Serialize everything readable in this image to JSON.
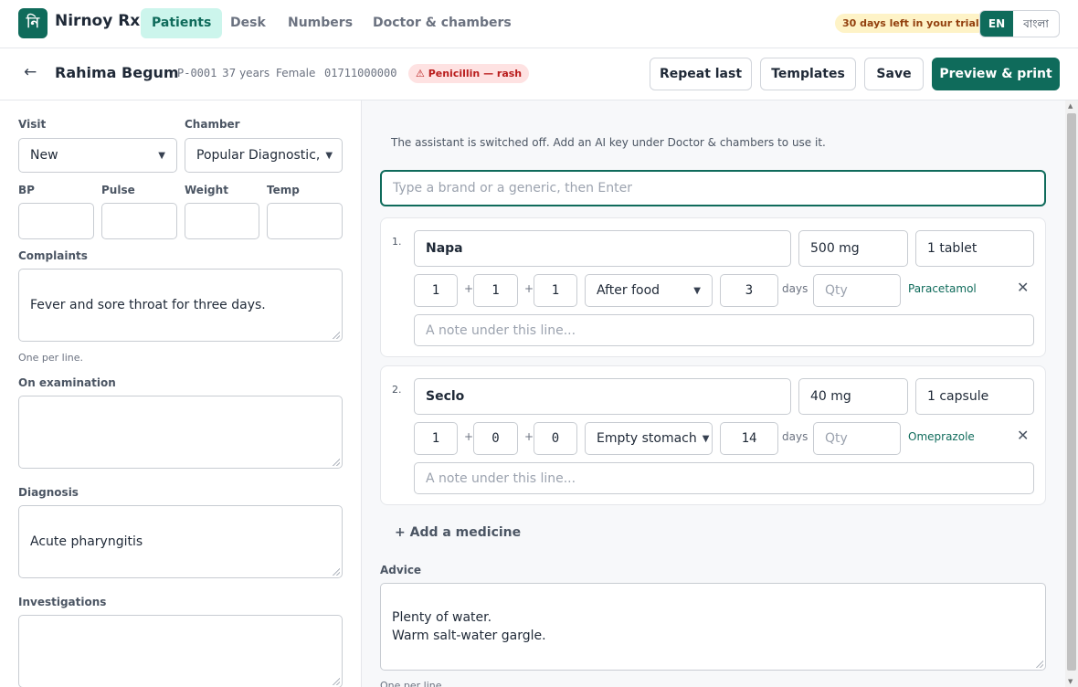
{
  "app": {
    "logo_glyph": "নি",
    "name": "Nirnoy Rx",
    "nav": [
      "Patients",
      "Desk",
      "Numbers",
      "Doctor & chambers"
    ],
    "active_nav": "Patients",
    "trial_badge": "30 days left in your trial",
    "lang_en": "EN",
    "lang_bn": "বাংলা",
    "accent_color": "#0f6b5b"
  },
  "patient": {
    "back_icon": "arrow-left-icon",
    "name": "Rahima Begum",
    "id": "P-0001",
    "age": "37 years",
    "sex": "Female",
    "phone": "01711000000",
    "allergy": "⚠ Penicillin — rash"
  },
  "actions": {
    "repeat_last": "Repeat last",
    "templates": "Templates",
    "save": "Save",
    "preview_print": "Preview & print"
  },
  "visit_form": {
    "visit_label": "Visit",
    "visit_value": "New",
    "chamber_label": "Chamber",
    "chamber_value": "Popular Diagnostic,",
    "bp_label": "BP",
    "pulse_label": "Pulse",
    "weight_label": "Weight",
    "temp_label": "Temp",
    "complaints_label": "Complaints",
    "complaints_value": "Fever and sore throat for three days.",
    "complaints_hint": "One per line.",
    "examination_label": "On examination",
    "diagnosis_label": "Diagnosis",
    "diagnosis_value": "Acute pharyngitis",
    "investigations_label": "Investigations"
  },
  "rx": {
    "assistant_notice": "The assistant is switched off. Add an AI key under Doctor & chambers to use it.",
    "search_placeholder": "Type a brand or a generic, then Enter",
    "medicines": [
      {
        "num": "1.",
        "brand": "Napa",
        "strength": "500 mg",
        "dose": "1 tablet",
        "morning": "1",
        "noon": "1",
        "night": "1",
        "timing": "After food",
        "duration": "3",
        "days_label": "days",
        "qty_placeholder": "Qty",
        "generic": "Paracetamol",
        "note_placeholder": "A note under this line..."
      },
      {
        "num": "2.",
        "brand": "Seclo",
        "strength": "40 mg",
        "dose": "1 capsule",
        "morning": "1",
        "noon": "0",
        "night": "0",
        "timing": "Empty stomach",
        "duration": "14",
        "days_label": "days",
        "qty_placeholder": "Qty",
        "generic": "Omeprazole",
        "note_placeholder": "A note under this line..."
      }
    ],
    "plus_sign": "+",
    "remove_glyph": "✕",
    "add_medicine": "+ Add a medicine",
    "advice_label": "Advice",
    "advice_value": "Plenty of water.\nWarm salt-water gargle.",
    "advice_hint": "One per line."
  }
}
